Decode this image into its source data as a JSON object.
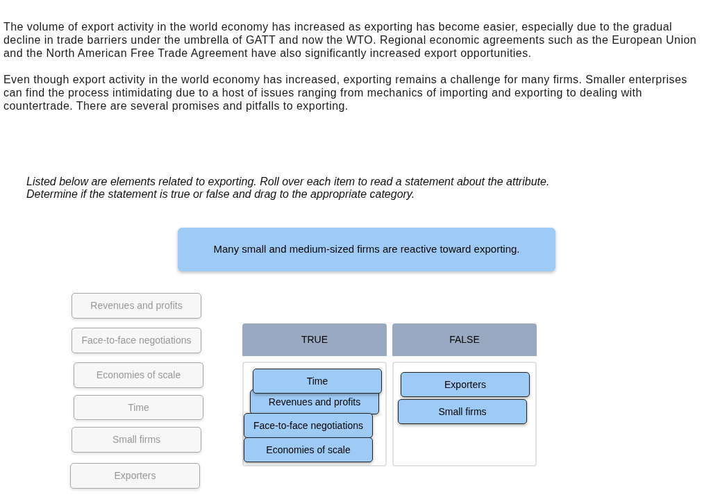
{
  "passage": [
    "The volume of export activity in the world economy has increased as exporting has become easier, especially due to the gradual decline in trade barriers under the umbrella of GATT and now the WTO. Regional economic agreements such as the European Union and the North American Free Trade Agreement have also significantly increased export opportunities.",
    "Even though export activity in the world economy has increased, exporting remains a challenge for many firms. Smaller enterprises can find the process intimidating due to a host of issues ranging from mechanics of importing and exporting to dealing with countertrade. There are several promises and pitfalls to exporting."
  ],
  "instructions": [
    "Listed below are elements related to exporting. Roll over each item to read a statement about the attribute.",
    "Determine if the statement is true or false and drag to the appropriate category."
  ],
  "statement": "Many small and medium-sized firms are reactive toward exporting.",
  "source_items": [
    {
      "label": "Revenues and profits",
      "placed": true
    },
    {
      "label": "Face-to-face negotiations",
      "placed": true
    },
    {
      "label": "Economies of scale",
      "placed": true
    },
    {
      "label": "Time",
      "placed": true
    },
    {
      "label": "Small firms",
      "placed": true
    },
    {
      "label": "Exporters",
      "placed": true
    }
  ],
  "categories": [
    {
      "title": "TRUE",
      "items": [
        "Time",
        "Revenues and profits",
        "Face-to-face negotiations",
        "Economies of scale"
      ]
    },
    {
      "title": "FALSE",
      "items": [
        "Exporters",
        "Small firms"
      ]
    }
  ]
}
